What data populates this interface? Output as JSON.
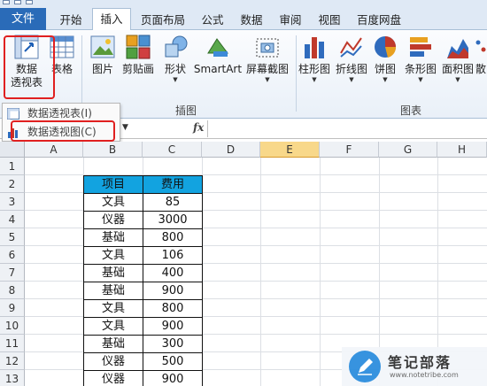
{
  "ribbon_tabs": {
    "file": "文件",
    "home": "开始",
    "insert": "插入",
    "page_layout": "页面布局",
    "formulas": "公式",
    "data": "数据",
    "review": "审阅",
    "view": "视图",
    "baidu_disk": "百度网盘"
  },
  "ribbon": {
    "pivot_line1": "数据",
    "pivot_line2": "透视表",
    "table": "表格",
    "picture": "图片",
    "clipart": "剪贴画",
    "shapes": "形状",
    "smartart": "SmartArt",
    "screenshot": "屏幕截图",
    "illustrations_group": "插图",
    "column_chart": "柱形图",
    "line_chart": "折线图",
    "pie_chart": "饼图",
    "bar_chart": "条形图",
    "area_chart": "面积图",
    "scatter_chart": "散",
    "charts_group": "图表"
  },
  "dropdown": {
    "pivot_table": "数据透视表(I)",
    "pivot_chart": "数据透视图(C)"
  },
  "formula_bar": {
    "fx": "fx"
  },
  "columns": [
    "A",
    "B",
    "C",
    "D",
    "E",
    "F",
    "G",
    "H"
  ],
  "selected_column": "E",
  "rows": [
    "1",
    "2",
    "3",
    "4",
    "5",
    "6",
    "7",
    "8",
    "9",
    "10",
    "11",
    "12",
    "13"
  ],
  "table": {
    "headers": [
      "项目",
      "费用"
    ],
    "rows": [
      [
        "文具",
        "85"
      ],
      [
        "仪器",
        "3000"
      ],
      [
        "基础",
        "800"
      ],
      [
        "文具",
        "106"
      ],
      [
        "基础",
        "400"
      ],
      [
        "基础",
        "900"
      ],
      [
        "文具",
        "800"
      ],
      [
        "文具",
        "900"
      ],
      [
        "基础",
        "300"
      ],
      [
        "仪器",
        "500"
      ],
      [
        "仪器",
        "900"
      ]
    ]
  },
  "colors": {
    "file_tab": "#2a6bb8",
    "header_fill": "#12a3e0",
    "highlight": "#e02020",
    "selected_col": "#f8d88a"
  },
  "watermark": {
    "title": "笔记部落",
    "url": "www.notetribe.com"
  }
}
